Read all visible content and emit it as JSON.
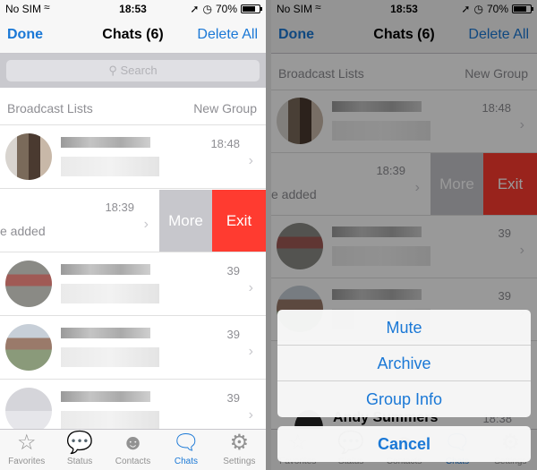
{
  "status_bar": {
    "carrier": "No SIM",
    "time": "18:53",
    "battery": "70%",
    "battery_level": 0.7,
    "location_icon": "location-arrow-icon",
    "alarm_icon": "alarm-icon",
    "wifi_icon": "wifi-icon"
  },
  "nav": {
    "done": "Done",
    "title": "Chats (6)",
    "delete_all": "Delete All"
  },
  "search": {
    "placeholder": "Search"
  },
  "lists": {
    "broadcast": "Broadcast Lists",
    "new_group": "New Group"
  },
  "chats": [
    {
      "time": "18:48",
      "preview": ""
    },
    {
      "time": "18:39",
      "preview": "e added"
    },
    {
      "time": "39",
      "preview": ""
    },
    {
      "time": "39",
      "preview": ""
    },
    {
      "time": "39",
      "preview": ""
    }
  ],
  "swipe_actions": {
    "more": "More",
    "exit": "Exit"
  },
  "tabs": [
    {
      "label": "Favorites",
      "icon": "star-icon"
    },
    {
      "label": "Status",
      "icon": "speech-bubble-icon"
    },
    {
      "label": "Contacts",
      "icon": "person-icon"
    },
    {
      "label": "Chats",
      "icon": "chats-icon",
      "active": true
    },
    {
      "label": "Settings",
      "icon": "gear-icon"
    }
  ],
  "action_sheet": {
    "items": [
      "Mute",
      "Archive",
      "Group Info"
    ],
    "cancel": "Cancel"
  },
  "background_row": {
    "name": "Andy Summers",
    "time": "18:38"
  },
  "colors": {
    "accent": "#1a78d6",
    "exit": "#ff3b30",
    "more": "#c7c7cc"
  }
}
